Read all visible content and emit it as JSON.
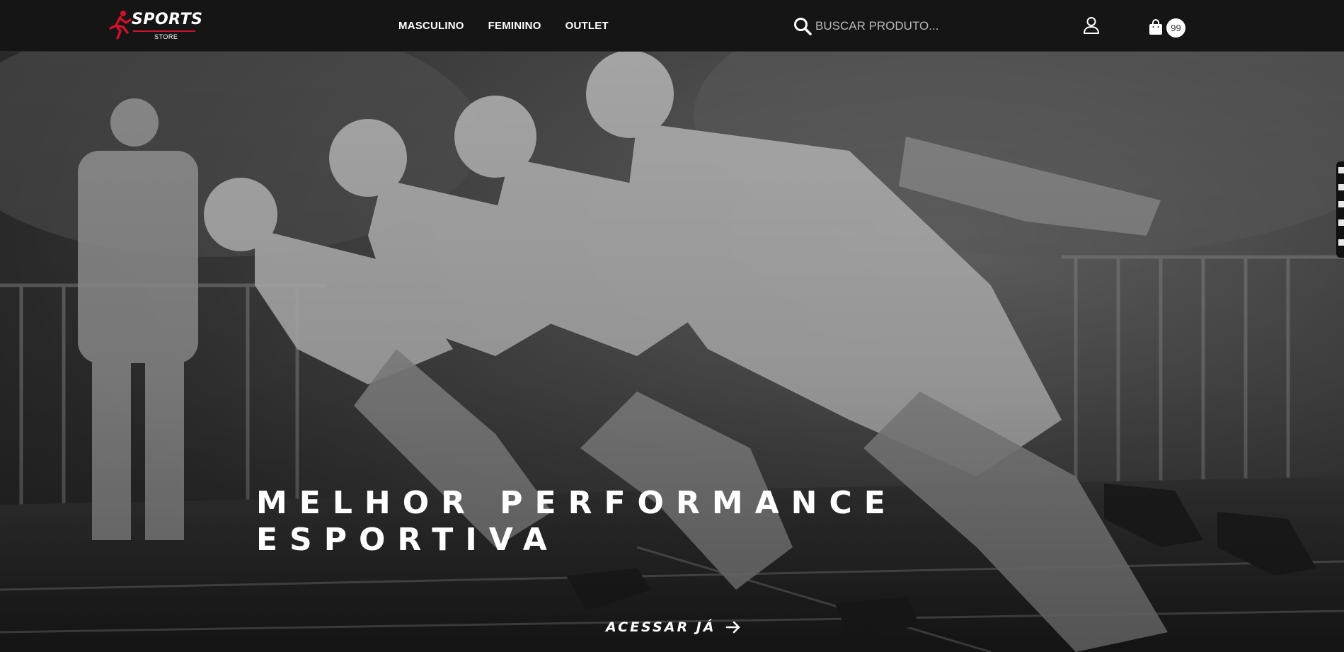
{
  "header": {
    "logo": {
      "word": "SPORTS",
      "sub": "STORE",
      "accent": "#d0112b"
    },
    "nav": [
      "MASCULINO",
      "FEMININO",
      "OUTLET"
    ],
    "search": {
      "placeholder": "BUSCAR PRODUTO...",
      "value": "",
      "icon": "search-icon"
    },
    "user_icon": "user-icon",
    "cart": {
      "icon": "shopping-bag-icon",
      "count": "99"
    }
  },
  "hero": {
    "title_line1": "MELHOR PERFORMANCE",
    "title_line2": "ESPORTIVA",
    "cta_label": "ACESSAR JÁ",
    "cta_icon": "arrow-right-icon"
  },
  "side_widget": {
    "icons": [
      "accessibility-icon",
      "widget-icon-1",
      "widget-icon-2",
      "widget-icon-3",
      "close-icon"
    ]
  }
}
